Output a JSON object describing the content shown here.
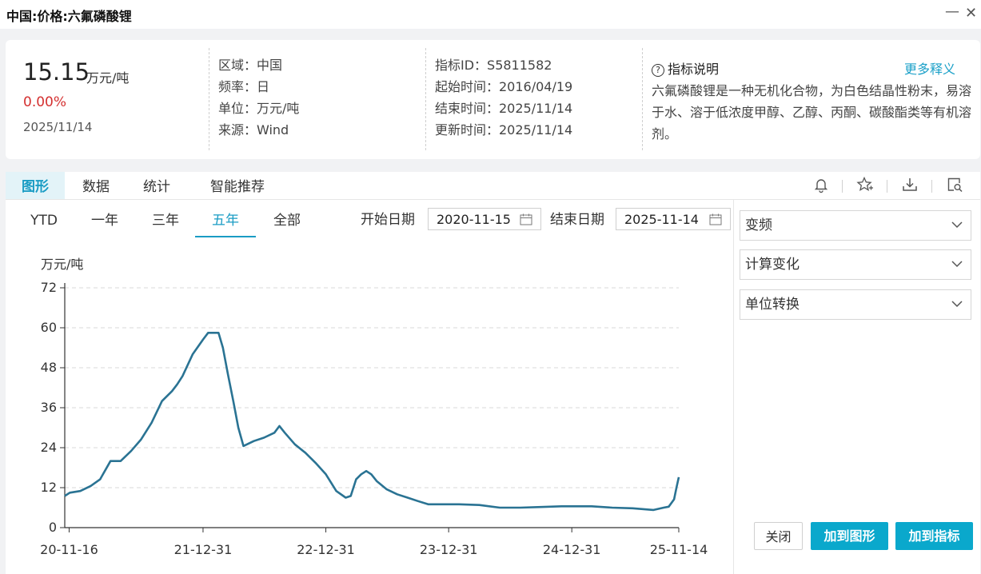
{
  "window": {
    "title": "中国:价格:六氟磷酸锂"
  },
  "summary": {
    "value": "15.15",
    "unit": "万元/吨",
    "change": "0.00%",
    "date": "2025/11/14"
  },
  "meta_col1": [
    "区域：中国",
    "频率：日",
    "单位：万元/吨",
    "来源：Wind"
  ],
  "meta_col2": [
    "指标ID：S5811582",
    "起始时间：2016/04/19",
    "结束时间：2025/11/14",
    "更新时间：2025/11/14"
  ],
  "description": {
    "heading": "指标说明",
    "more_label": "更多释义",
    "text": "六氟磷酸锂是一种无机化合物，为白色结晶性粉末，易溶于水、溶于低浓度甲醇、乙醇、丙酮、碳酸酯类等有机溶剂。"
  },
  "tabs": [
    "图形",
    "数据",
    "统计",
    "智能推荐"
  ],
  "toolbar_icons": [
    "bell-icon",
    "star-add-icon",
    "download-icon",
    "search-window-icon"
  ],
  "ranges": [
    "YTD",
    "一年",
    "三年",
    "五年",
    "全部"
  ],
  "active_range": "五年",
  "date_range": {
    "start_label": "开始日期",
    "start_value": "2020-11-15",
    "end_label": "结束日期",
    "end_value": "2025-11-14"
  },
  "side_panel": {
    "selects": [
      "变频",
      "计算变化",
      "单位转换"
    ],
    "close_label": "关闭",
    "add_chart_label": "加到图形",
    "add_indicator_label": "加到指标"
  },
  "colors": {
    "accent": "#1a9cc4",
    "line": "#2a7393",
    "negative": "#d43030",
    "button": "#0aa8cc"
  },
  "chart_data": {
    "type": "line",
    "ylabel": "万元/吨",
    "ylim": [
      0,
      72
    ],
    "yticks": [
      0,
      12,
      24,
      36,
      48,
      60,
      72
    ],
    "xticks": [
      "20-11-16",
      "21-12-31",
      "22-12-31",
      "23-12-31",
      "24-12-31",
      "25-11-14"
    ],
    "grid": true,
    "series": [
      {
        "x": [
          "2020-11-15",
          "2020-11-30",
          "2020-12-31",
          "2021-01-31",
          "2021-02-28",
          "2021-03-31",
          "2021-04-30",
          "2021-05-31",
          "2021-06-30",
          "2021-07-31",
          "2021-08-31",
          "2021-09-30",
          "2021-10-15",
          "2021-10-31",
          "2021-11-30",
          "2021-12-31",
          "2022-01-15",
          "2022-01-31",
          "2022-02-15",
          "2022-02-28",
          "2022-03-15",
          "2022-03-31",
          "2022-04-15",
          "2022-04-30",
          "2022-05-31",
          "2022-06-30",
          "2022-07-31",
          "2022-08-15",
          "2022-08-31",
          "2022-09-30",
          "2022-10-31",
          "2022-11-30",
          "2022-12-31",
          "2023-01-31",
          "2023-02-28",
          "2023-03-15",
          "2023-03-31",
          "2023-04-15",
          "2023-04-30",
          "2023-05-15",
          "2023-05-31",
          "2023-06-30",
          "2023-07-31",
          "2023-08-31",
          "2023-09-30",
          "2023-10-31",
          "2023-11-30",
          "2023-12-31",
          "2024-01-31",
          "2024-03-31",
          "2024-05-31",
          "2024-07-31",
          "2024-09-30",
          "2024-11-30",
          "2024-12-31",
          "2025-02-28",
          "2025-04-30",
          "2025-06-30",
          "2025-08-31",
          "2025-09-30",
          "2025-10-15",
          "2025-10-31",
          "2025-11-07",
          "2025-11-14"
        ],
        "values": [
          9.5,
          10.5,
          11.0,
          12.5,
          14.5,
          20.0,
          20.0,
          23.0,
          26.5,
          31.5,
          38.0,
          41.0,
          43.0,
          45.5,
          52.0,
          56.5,
          58.5,
          58.5,
          58.5,
          54.0,
          46.0,
          38.0,
          30.0,
          24.5,
          26.0,
          27.0,
          28.5,
          30.5,
          28.5,
          25.0,
          22.5,
          19.5,
          16.0,
          11.0,
          9.0,
          9.5,
          14.5,
          16.0,
          17.0,
          16.0,
          14.0,
          11.5,
          10.0,
          9.0,
          8.0,
          7.0,
          7.0,
          7.0,
          7.0,
          6.8,
          6.0,
          6.0,
          6.2,
          6.4,
          6.4,
          6.4,
          6.0,
          5.8,
          5.3,
          6.0,
          6.3,
          8.5,
          12.0,
          15.15
        ]
      }
    ]
  }
}
